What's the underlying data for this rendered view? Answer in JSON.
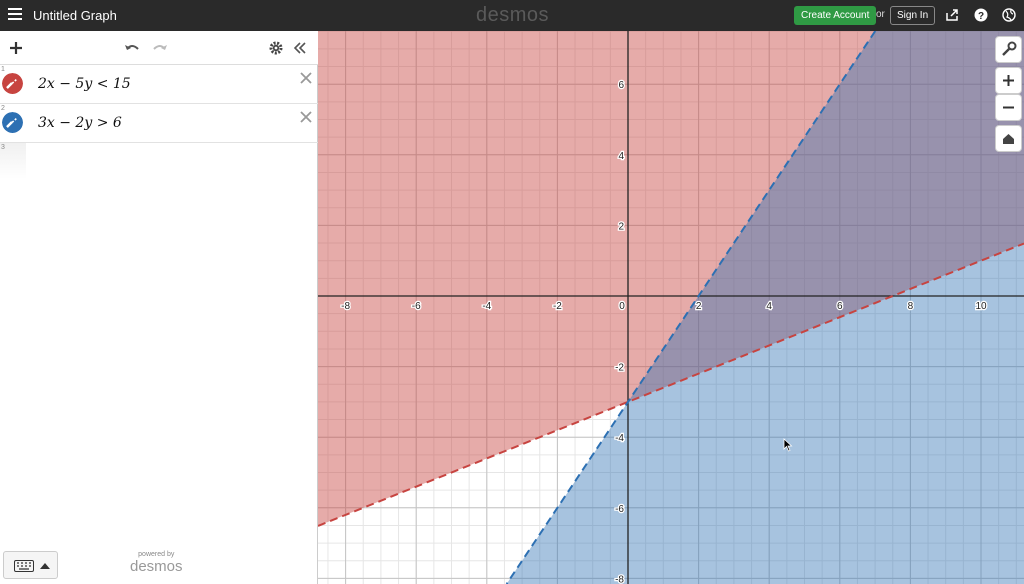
{
  "topbar": {
    "title": "Untitled Graph",
    "brand": "desmos",
    "create_account": "Create Account",
    "or": "or",
    "sign_in": "Sign In"
  },
  "expressions": [
    {
      "index": "1",
      "latex": "2x − 5y < 15",
      "color": "#c74440"
    },
    {
      "index": "2",
      "latex": "3x − 2y > 6",
      "color": "#2d70b3"
    },
    {
      "index": "3"
    }
  ],
  "footer": {
    "powered_by": "powered by",
    "brand": "desmos"
  },
  "graph": {
    "x_ticks": [
      "-8",
      "-6",
      "-4",
      "-2",
      "0",
      "2",
      "4",
      "6",
      "8",
      "10"
    ],
    "y_ticks": [
      "6",
      "4",
      "2",
      "-2",
      "-4",
      "-6",
      "-8"
    ],
    "colors": {
      "red_fill": "#c74440",
      "blue_fill": "#2d70b3"
    }
  }
}
